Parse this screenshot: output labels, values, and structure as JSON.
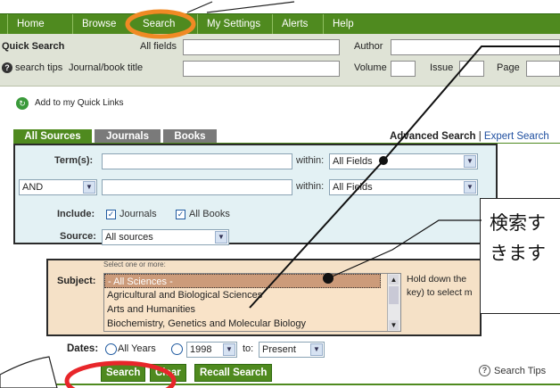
{
  "nav": {
    "items": [
      "Home",
      "Browse",
      "Search",
      "My Settings",
      "Alerts",
      "Help"
    ]
  },
  "quick_search": {
    "title": "Quick Search",
    "all_fields_label": "All fields",
    "author_label": "Author",
    "tips_label": "search tips",
    "journal_label": "Journal/book title",
    "volume_label": "Volume",
    "issue_label": "Issue",
    "page_label": "Page"
  },
  "quick_links": {
    "label": "Add to my Quick Links"
  },
  "tabs": [
    "All Sources",
    "Journals",
    "Books"
  ],
  "search_modes": {
    "advanced": "Advanced Search",
    "separator": "|",
    "expert": "Expert Search"
  },
  "form": {
    "terms_label": "Term(s):",
    "within_label": "within:",
    "within_value_1": "All Fields",
    "within_value_2": "All Fields",
    "operator_value": "AND",
    "include_label": "Include:",
    "journals_label": "Journals",
    "books_label": "All Books",
    "source_label": "Source:",
    "source_value": "All sources"
  },
  "subject": {
    "hint": "Select one or more:",
    "label": "Subject:",
    "options": [
      "- All Sciences -",
      "Agricultural and Biological Sciences",
      "Arts and Humanities",
      "Biochemistry, Genetics and Molecular Biology"
    ],
    "selected_index": 0,
    "help_line1": "Hold down the",
    "help_line2": "key) to select m"
  },
  "dates": {
    "label": "Dates:",
    "all_years_label": "All Years",
    "from_value": "1998",
    "to_label": "to:",
    "to_value": "Present"
  },
  "buttons": {
    "search": "Search",
    "clear": "Clear",
    "recall": "Recall Search"
  },
  "search_tips": {
    "label": "Search Tips"
  },
  "callout": {
    "line1": "検索す",
    "line2": "きます"
  },
  "colors": {
    "nav_green": "#4f8a1f",
    "annotation_red": "#e8262a",
    "highlight_orange": "#f08a24",
    "search_panel": "#e3f1f4",
    "subject_panel": "#f5e1c7"
  }
}
